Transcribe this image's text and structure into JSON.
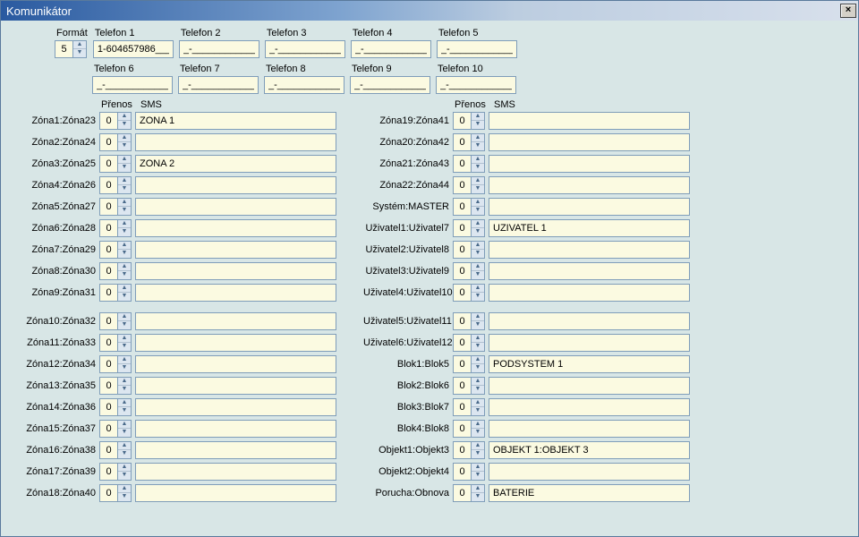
{
  "window": {
    "title": "Komunikátor",
    "close": "×"
  },
  "labels": {
    "format": "Formát",
    "prenos": "Přenos",
    "sms": "SMS"
  },
  "format_value": "5",
  "phones": [
    {
      "label": "Telefon 1",
      "value": "1-604657986___"
    },
    {
      "label": "Telefon 2",
      "value": "_-_____________"
    },
    {
      "label": "Telefon 3",
      "value": "_-_____________"
    },
    {
      "label": "Telefon 4",
      "value": "_-_____________"
    },
    {
      "label": "Telefon 5",
      "value": "_-_____________"
    },
    {
      "label": "Telefon 6",
      "value": "_-_____________"
    },
    {
      "label": "Telefon 7",
      "value": "_-_____________"
    },
    {
      "label": "Telefon 8",
      "value": "_-_____________"
    },
    {
      "label": "Telefon 9",
      "value": "_-_____________"
    },
    {
      "label": "Telefon 10",
      "value": "_-_____________"
    }
  ],
  "left": [
    {
      "label": "Zóna1:Zóna23",
      "p": "0",
      "sms": "ZONA 1"
    },
    {
      "label": "Zóna2:Zóna24",
      "p": "0",
      "sms": ""
    },
    {
      "label": "Zóna3:Zóna25",
      "p": "0",
      "sms": "ZONA 2"
    },
    {
      "label": "Zóna4:Zóna26",
      "p": "0",
      "sms": ""
    },
    {
      "label": "Zóna5:Zóna27",
      "p": "0",
      "sms": ""
    },
    {
      "label": "Zóna6:Zóna28",
      "p": "0",
      "sms": ""
    },
    {
      "label": "Zóna7:Zóna29",
      "p": "0",
      "sms": ""
    },
    {
      "label": "Zóna8:Zóna30",
      "p": "0",
      "sms": ""
    },
    {
      "label": "Zóna9:Zóna31",
      "p": "0",
      "sms": ""
    },
    {
      "gap": true
    },
    {
      "label": "Zóna10:Zóna32",
      "p": "0",
      "sms": ""
    },
    {
      "label": "Zóna11:Zóna33",
      "p": "0",
      "sms": ""
    },
    {
      "label": "Zóna12:Zóna34",
      "p": "0",
      "sms": ""
    },
    {
      "label": "Zóna13:Zóna35",
      "p": "0",
      "sms": ""
    },
    {
      "label": "Zóna14:Zóna36",
      "p": "0",
      "sms": ""
    },
    {
      "label": "Zóna15:Zóna37",
      "p": "0",
      "sms": ""
    },
    {
      "label": "Zóna16:Zóna38",
      "p": "0",
      "sms": ""
    },
    {
      "label": "Zóna17:Zóna39",
      "p": "0",
      "sms": ""
    },
    {
      "label": "Zóna18:Zóna40",
      "p": "0",
      "sms": ""
    }
  ],
  "right": [
    {
      "label": "Zóna19:Zóna41",
      "p": "0",
      "sms": ""
    },
    {
      "label": "Zóna20:Zóna42",
      "p": "0",
      "sms": ""
    },
    {
      "label": "Zóna21:Zóna43",
      "p": "0",
      "sms": ""
    },
    {
      "label": "Zóna22:Zóna44",
      "p": "0",
      "sms": ""
    },
    {
      "label": "Systém:MASTER",
      "p": "0",
      "sms": ""
    },
    {
      "label": "Uživatel1:Uživatel7",
      "p": "0",
      "sms": "UZIVATEL 1"
    },
    {
      "label": "Uživatel2:Uživatel8",
      "p": "0",
      "sms": ""
    },
    {
      "label": "Uživatel3:Uživatel9",
      "p": "0",
      "sms": ""
    },
    {
      "label": "Uživatel4:Uživatel10",
      "p": "0",
      "sms": ""
    },
    {
      "gap": true
    },
    {
      "label": "Uživatel5:Uživatel11",
      "p": "0",
      "sms": ""
    },
    {
      "label": "Uživatel6:Uživatel12",
      "p": "0",
      "sms": ""
    },
    {
      "label": "Blok1:Blok5",
      "p": "0",
      "sms": "PODSYSTEM 1"
    },
    {
      "label": "Blok2:Blok6",
      "p": "0",
      "sms": ""
    },
    {
      "label": "Blok3:Blok7",
      "p": "0",
      "sms": ""
    },
    {
      "label": "Blok4:Blok8",
      "p": "0",
      "sms": ""
    },
    {
      "label": "Objekt1:Objekt3",
      "p": "0",
      "sms": "OBJEKT 1:OBJEKT 3"
    },
    {
      "label": "Objekt2:Objekt4",
      "p": "0",
      "sms": ""
    },
    {
      "label": "Porucha:Obnova",
      "p": "0",
      "sms": "BATERIE"
    }
  ]
}
